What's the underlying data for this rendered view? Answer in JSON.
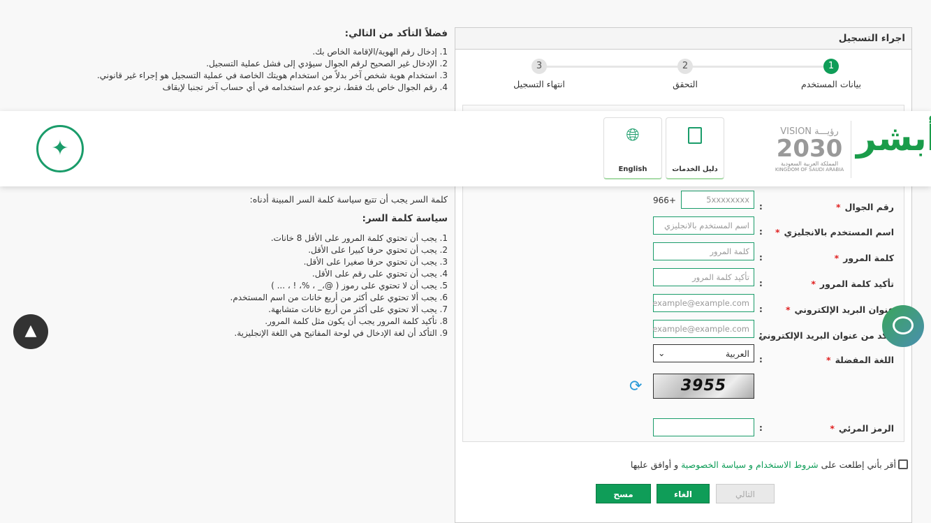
{
  "notes": {
    "title": "فضلاً التأكد من التالي:",
    "items": [
      "1. إدخال رقم الهوية/الإقامة الخاص بك.",
      "2. الإدخال غير الصحيح لرقم الجوال سيؤدي إلى فشل عملية التسجيل.",
      "3. استخدام هوية شخص آخر بدلاً من استخدام هويتك الخاصة في عملية التسجيل هو إجراء غير قانوني.",
      "4. رقم الجوال خاص بك فقط، نرجو عدم استخدامه في أي حساب آخر تجنبا لإيقاف"
    ]
  },
  "password_policy": {
    "intro": "كلمة السر يجب أن تتبع سياسة كلمة السر المبينة أدناه:",
    "title": "سياسة كلمة السر:",
    "items": [
      "1. يجب أن تحتوي كلمة المرور على الأقل 8 خانات.",
      "2. يجب أن تحتوي حرفا كبيرا على الأقل.",
      "3. يجب أن تحتوي حرفا صغيرا على الأقل.",
      "4. يجب أن تحتوي على رقم على الأقل.",
      "5. يجب أن لا تحتوي على رموز ( @،_ ، %، ! ، ... )",
      "6. يجب ألا تحتوي على أكثر من أربع خانات من اسم المستخدم.",
      "7. يجب ألا تحتوي على أكثر من أربع خانات متشابهة.",
      "8. تأكيد كلمة المرور يجب أن يكون مثل كلمة المرور.",
      "9. التأكد أن لغة الإدخال في لوحة المفاتيح هي اللغة الإنجليزية."
    ]
  },
  "panel": {
    "title": "اجراء التسجيل",
    "steps": [
      {
        "num": "1",
        "label": "بيانات المستخدم",
        "active": true
      },
      {
        "num": "2",
        "label": "التحقق"
      },
      {
        "num": "3",
        "label": "انتهاء التسجيل"
      }
    ]
  },
  "form": {
    "colon": ":",
    "required": "*",
    "mobile": {
      "label": "رقم الجوال",
      "prefix": "+966",
      "placeholder": "5xxxxxxxx"
    },
    "username": {
      "label": "اسم المستخدم بالانجليزي",
      "placeholder": "اسم المستخدم بالانجليزي"
    },
    "password": {
      "label": "كلمة المرور",
      "placeholder": "كلمة المرور"
    },
    "confirm_password": {
      "label": "تأكيد كلمة المرور",
      "placeholder": "تأكيد كلمة المرور"
    },
    "email": {
      "label": "عنوان البريد الإلكتروني",
      "placeholder": "example@example.com"
    },
    "confirm_email": {
      "label": "تأكد من عنوان البريد الإلكتروني",
      "placeholder": "example@example.com"
    },
    "language": {
      "label": "اللغة المفضلة",
      "value": "العربية"
    },
    "captcha": {
      "text": "3955",
      "label": "الرمز المرئي"
    },
    "terms": {
      "prefix": "أقر بأني إطلعت على",
      "link": "شروط الاستخدام و سياسة الخصوصية",
      "suffix": "و أوافق عليها"
    },
    "buttons": {
      "next": "التالي",
      "cancel": "الغاء",
      "clear": "مسح"
    }
  },
  "header": {
    "guide_label": "دليل الخدمات",
    "english_label": "English",
    "vision_text": "VISION رؤيـــة",
    "vision_year": "2030",
    "kingdom_ar": "المملكة العربية السعودية",
    "kingdom_en": "KINGDOM OF SAUDI ARABIA",
    "logo": "أبشر"
  },
  "colors": {
    "primary": "#0f9d58",
    "required": "#e02020",
    "link": "#0f9d58"
  }
}
